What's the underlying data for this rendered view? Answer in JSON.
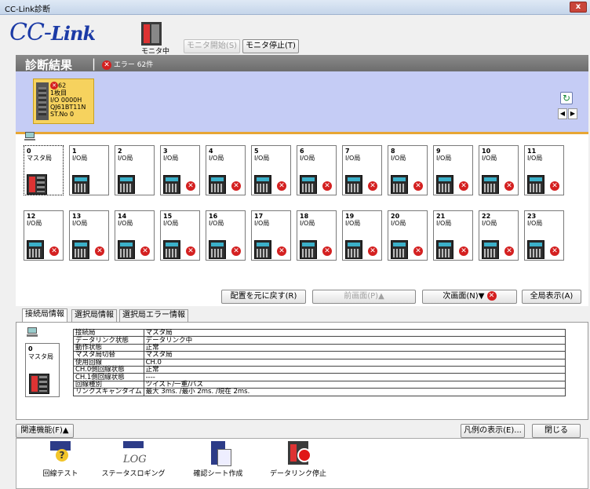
{
  "window": {
    "title": "CC-Link診断",
    "close": "x"
  },
  "header": {
    "logo_main": "CC-",
    "logo_sub": "Link",
    "monitor_status": "モニタ中",
    "monitor_start": "モニタ開始(S)",
    "monitor_stop": "モニタ停止(T)"
  },
  "result": {
    "heading": "診断結果",
    "separator": "|",
    "error_label": "エラー 62件"
  },
  "master_card": {
    "err_count": "62",
    "line2": "1枚目",
    "line3": "I/O 0000H",
    "line4": "QJ61BT11N",
    "line5": "ST.No 0"
  },
  "nav": {
    "refresh": "↻",
    "left": "◀",
    "right": "▶"
  },
  "stations": [
    {
      "num": "0",
      "type": "マスタ局",
      "error": false,
      "master": true
    },
    {
      "num": "1",
      "type": "I/O局",
      "error": false
    },
    {
      "num": "2",
      "type": "I/O局",
      "error": false
    },
    {
      "num": "3",
      "type": "I/O局",
      "error": true
    },
    {
      "num": "4",
      "type": "I/O局",
      "error": true
    },
    {
      "num": "5",
      "type": "I/O局",
      "error": true
    },
    {
      "num": "6",
      "type": "I/O局",
      "error": true
    },
    {
      "num": "7",
      "type": "I/O局",
      "error": true
    },
    {
      "num": "8",
      "type": "I/O局",
      "error": true
    },
    {
      "num": "9",
      "type": "I/O局",
      "error": true
    },
    {
      "num": "10",
      "type": "I/O局",
      "error": true
    },
    {
      "num": "11",
      "type": "I/O局",
      "error": true
    },
    {
      "num": "12",
      "type": "I/O局",
      "error": true
    },
    {
      "num": "13",
      "type": "I/O局",
      "error": true
    },
    {
      "num": "14",
      "type": "I/O局",
      "error": true
    },
    {
      "num": "15",
      "type": "I/O局",
      "error": true
    },
    {
      "num": "16",
      "type": "I/O局",
      "error": true
    },
    {
      "num": "17",
      "type": "I/O局",
      "error": true
    },
    {
      "num": "18",
      "type": "I/O局",
      "error": true
    },
    {
      "num": "19",
      "type": "I/O局",
      "error": true
    },
    {
      "num": "20",
      "type": "I/O局",
      "error": true
    },
    {
      "num": "21",
      "type": "I/O局",
      "error": true
    },
    {
      "num": "22",
      "type": "I/O局",
      "error": true
    },
    {
      "num": "23",
      "type": "I/O局",
      "error": true
    }
  ],
  "board_buttons": {
    "restore": "配置を元に戻す(R)",
    "prev": "前画面(P)▲",
    "next": "次画面(N)▼",
    "all": "全局表示(A)"
  },
  "tabs": [
    "接続局情報",
    "選択局情報",
    "選択局エラー情報"
  ],
  "conn_station": {
    "num": "0",
    "type": "マスタ局"
  },
  "info_rows": [
    {
      "k": "接続局",
      "v": "マスタ局"
    },
    {
      "k": "データリンク状態",
      "v": "データリンク中"
    },
    {
      "k": "動作状態",
      "v": "正常"
    },
    {
      "k": "マスタ局切替",
      "v": "マスタ局"
    },
    {
      "k": "使用回線",
      "v": "CH.0"
    },
    {
      "k": "CH.0側回線状態",
      "v": "正常"
    },
    {
      "k": "CH.1側回線状態",
      "v": "----"
    },
    {
      "k": "回線種別",
      "v": "ツイスト/一重/バス"
    },
    {
      "k": "リンクスキャンタイム",
      "v": "最大 3ms. /最小 2ms. /現在 2ms."
    }
  ],
  "bottom": {
    "related": "関連機能(F)▲",
    "legend": "凡例の表示(E)...",
    "close": "閉じる"
  },
  "functions": [
    {
      "label": "回線テスト",
      "icon": "line-test-icon"
    },
    {
      "label": "ステータスロギング",
      "icon": "status-logging-icon"
    },
    {
      "label": "確認シート作成",
      "icon": "check-sheet-icon"
    },
    {
      "label": "データリンク停止",
      "icon": "datalink-stop-icon"
    }
  ]
}
